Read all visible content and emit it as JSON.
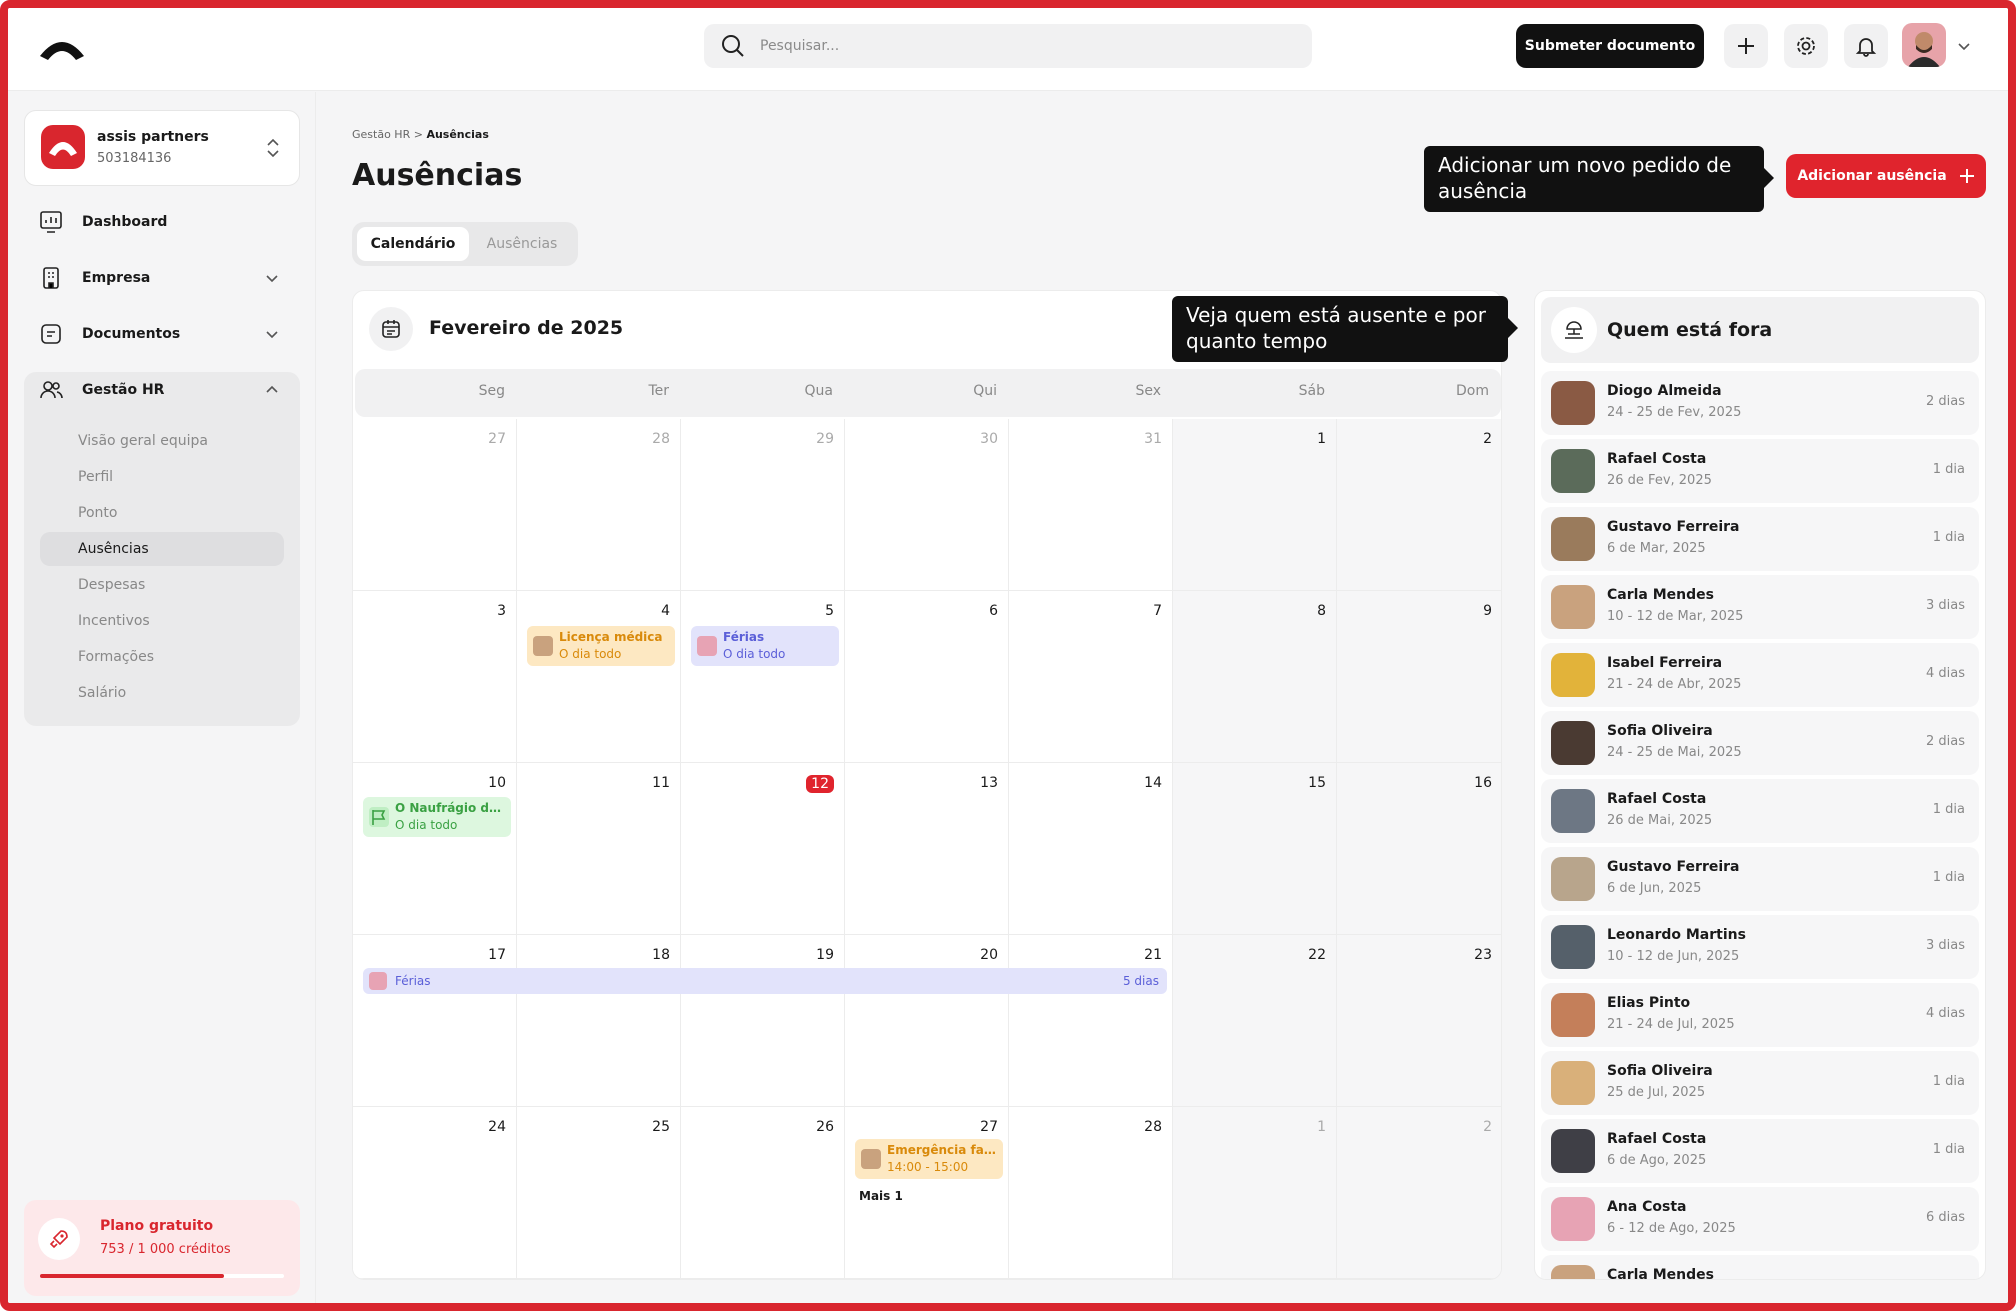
{
  "topbar": {
    "search_placeholder": "Pesquisar...",
    "submit_label": "Submeter documento"
  },
  "sidebar": {
    "company_name": "assis partners",
    "company_id": "503184136",
    "items": [
      {
        "label": "Dashboard"
      },
      {
        "label": "Empresa"
      },
      {
        "label": "Documentos"
      },
      {
        "label": "Gestão HR"
      }
    ],
    "hr_sub": [
      {
        "label": "Visão geral equipa"
      },
      {
        "label": "Perfil"
      },
      {
        "label": "Ponto"
      },
      {
        "label": "Ausências"
      },
      {
        "label": "Despesas"
      },
      {
        "label": "Incentivos"
      },
      {
        "label": "Formações"
      },
      {
        "label": "Salário"
      }
    ],
    "plan_title": "Plano gratuito",
    "plan_credits": "753 / 1 000 créditos",
    "plan_progress": 0.753
  },
  "main": {
    "breadcrumb_parent": "Gestão HR",
    "breadcrumb_sep": " > ",
    "breadcrumb_current": "Ausências",
    "title": "Ausências",
    "tab_calendar": "Calendário",
    "tab_absences": "Ausências",
    "add_button": "Adicionar ausência",
    "tooltip_add": "Adicionar um novo pedido de ausência",
    "tooltip_who": "Veja quem está ausente e por quanto tempo"
  },
  "calendar": {
    "month": "Fevereiro de 2025",
    "weekdays": [
      "Seg",
      "Ter",
      "Qua",
      "Qui",
      "Sex",
      "Sáb",
      "Dom"
    ],
    "weeks": [
      [
        "27",
        "28",
        "29",
        "30",
        "31",
        "1",
        "2"
      ],
      [
        "3",
        "4",
        "5",
        "6",
        "7",
        "8",
        "9"
      ],
      [
        "10",
        "11",
        "12",
        "13",
        "14",
        "15",
        "16"
      ],
      [
        "17",
        "18",
        "19",
        "20",
        "21",
        "22",
        "23"
      ],
      [
        "24",
        "25",
        "26",
        "27",
        "28",
        "1",
        "2"
      ]
    ],
    "today": "12",
    "events": {
      "e1_title": "Licença médica",
      "e1_sub": "O dia todo",
      "e2_title": "Férias",
      "e2_sub": "O dia todo",
      "e3_title": "O Naufrágio de S...",
      "e3_sub": "O dia todo",
      "e4_title": "Férias",
      "e4_days": "5 dias",
      "e5_title": "Emergência fami...",
      "e5_sub": "14:00 - 15:00",
      "more": "Mais 1"
    },
    "colors": {
      "accent": "#e0242d",
      "orange": "#d98a0b",
      "purple": "#5b5fd8",
      "green": "#3aa143"
    }
  },
  "panel": {
    "title": "Quem está fora",
    "people": [
      {
        "name": "Diogo Almeida",
        "dates": "24 - 25 de Fev, 2025",
        "days": "2 dias",
        "color": "#8a5a44"
      },
      {
        "name": "Rafael Costa",
        "dates": "26 de Fev, 2025",
        "days": "1 dia",
        "color": "#5b6b5a"
      },
      {
        "name": "Gustavo Ferreira",
        "dates": "6 de Mar, 2025",
        "days": "1 dia",
        "color": "#9a7b5c"
      },
      {
        "name": "Carla Mendes",
        "dates": "10 - 12 de Mar, 2025",
        "days": "3 dias",
        "color": "#c9a27e"
      },
      {
        "name": "Isabel Ferreira",
        "dates": "21 - 24 de Abr, 2025",
        "days": "4 dias",
        "color": "#e2b33a"
      },
      {
        "name": "Sofia Oliveira",
        "dates": "24 - 25 de Mai, 2025",
        "days": "2 dias",
        "color": "#4a3a32"
      },
      {
        "name": "Rafael Costa",
        "dates": "26 de Mai, 2025",
        "days": "1 dia",
        "color": "#6d7784"
      },
      {
        "name": "Gustavo Ferreira",
        "dates": "6 de Jun, 2025",
        "days": "1 dia",
        "color": "#b8a58c"
      },
      {
        "name": "Leonardo Martins",
        "dates": "10 - 12 de Jun, 2025",
        "days": "3 dias",
        "color": "#55606a"
      },
      {
        "name": "Elias Pinto",
        "dates": "21 - 24 de Jul, 2025",
        "days": "4 dias",
        "color": "#c47f5a"
      },
      {
        "name": "Sofia Oliveira",
        "dates": "25 de Jul, 2025",
        "days": "1 dia",
        "color": "#d9b07a"
      },
      {
        "name": "Rafael Costa",
        "dates": "6 de Ago, 2025",
        "days": "1 dia",
        "color": "#3f3f46"
      },
      {
        "name": "Ana Costa",
        "dates": "6 - 12 de Ago, 2025",
        "days": "6 dias",
        "color": "#e7a3b4"
      },
      {
        "name": "Carla Mendes",
        "dates": "",
        "days": "",
        "color": "#c9a27e"
      }
    ]
  }
}
